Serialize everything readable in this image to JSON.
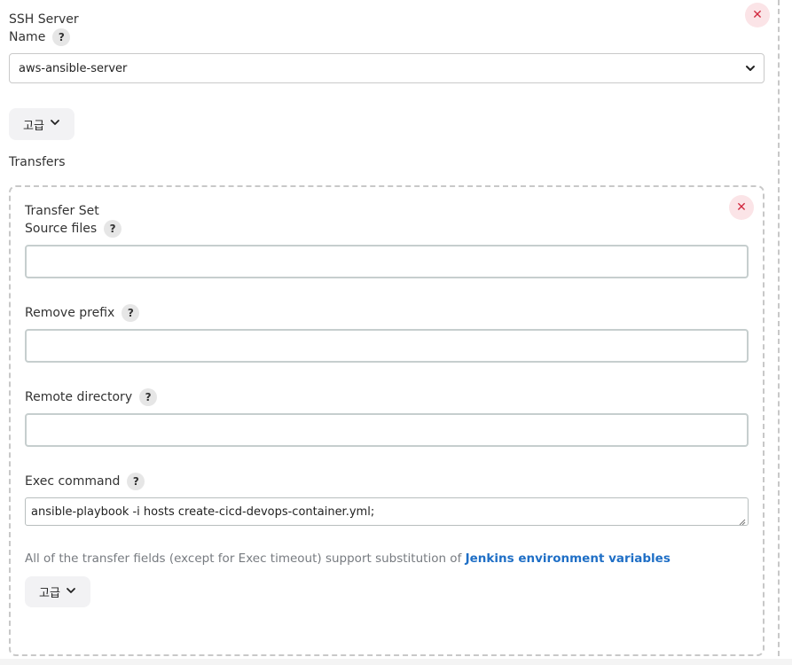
{
  "ssh_server": {
    "section_label": "SSH Server",
    "name_label": "Name",
    "help_glyph": "?",
    "selected_server": "aws-ansible-server",
    "advanced_label": "고급",
    "close_glyph": "✕"
  },
  "transfers": {
    "heading": "Transfers",
    "transfer_set": {
      "title": "Transfer Set",
      "close_glyph": "✕",
      "source_files_label": "Source files",
      "source_files_value": "",
      "remove_prefix_label": "Remove prefix",
      "remove_prefix_value": "",
      "remote_directory_label": "Remote directory",
      "remote_directory_value": "",
      "exec_command_label": "Exec command",
      "exec_command_value": "ansible-playbook -i hosts create-cicd-devops-container.yml;",
      "note_text": "All of the transfer fields (except for Exec timeout) support substitution of",
      "note_link": "Jenkins environment variables",
      "advanced_label": "고급"
    }
  },
  "colors": {
    "close_bg": "#fbe4e7",
    "close_fg": "#d1293f",
    "link": "#1f6fc6",
    "help_bg": "#e6e6e6"
  },
  "icons": {
    "help": "question-mark-icon",
    "close": "close-icon",
    "dropdown": "chevron-down-icon",
    "resize": "resize-grip-icon"
  }
}
